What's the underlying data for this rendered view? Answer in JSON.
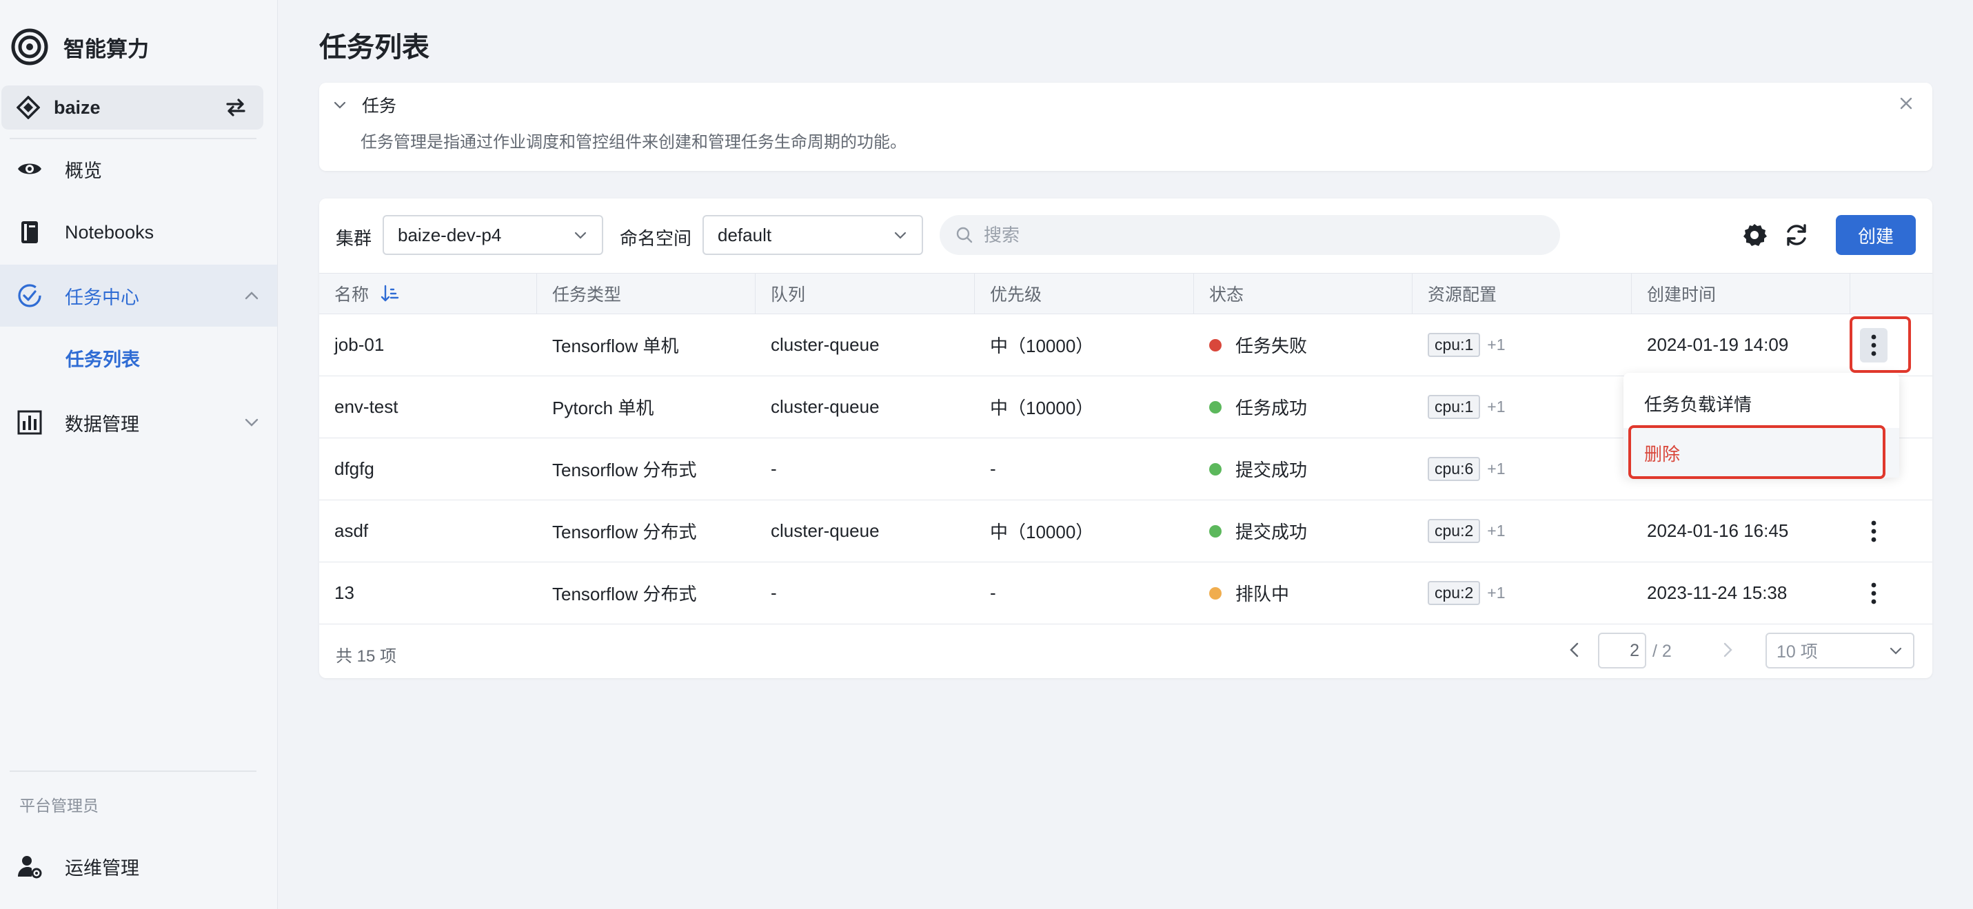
{
  "app": {
    "brand_title": "智能算力",
    "workspace": "baize"
  },
  "sidebar": {
    "items": [
      {
        "label": "概览"
      },
      {
        "label": "Notebooks"
      },
      {
        "label": "任务中心"
      },
      {
        "label": "数据管理"
      }
    ],
    "sub_item": "任务列表",
    "section_label": "平台管理员",
    "bottom_item": "运维管理"
  },
  "page": {
    "title": "任务列表"
  },
  "info": {
    "title": "任务",
    "description": "任务管理是指通过作业调度和管控组件来创建和管理任务生命周期的功能。"
  },
  "toolbar": {
    "cluster_label": "集群",
    "cluster_value": "baize-dev-p4",
    "namespace_label": "命名空间",
    "namespace_value": "default",
    "search_placeholder": "搜索",
    "create_label": "创建"
  },
  "table": {
    "columns": [
      "名称",
      "任务类型",
      "队列",
      "优先级",
      "状态",
      "资源配置",
      "创建时间"
    ],
    "rows": [
      {
        "name": "job-01",
        "type": "Tensorflow 单机",
        "queue": "cluster-queue",
        "priority": "中（10000）",
        "status": "任务失败",
        "status_color": "#d9473b",
        "resource": "cpu:1",
        "resource_more": "+1",
        "created": "2024-01-19 14:09"
      },
      {
        "name": "env-test",
        "type": "Pytorch 单机",
        "queue": "cluster-queue",
        "priority": "中（10000）",
        "status": "任务成功",
        "status_color": "#5cb85c",
        "resource": "cpu:1",
        "resource_more": "+1",
        "created": ""
      },
      {
        "name": "dfgfg",
        "type": "Tensorflow 分布式",
        "queue": "-",
        "priority": "-",
        "status": "提交成功",
        "status_color": "#5cb85c",
        "resource": "cpu:6",
        "resource_more": "+1",
        "created": ""
      },
      {
        "name": "asdf",
        "type": "Tensorflow 分布式",
        "queue": "cluster-queue",
        "priority": "中（10000）",
        "status": "提交成功",
        "status_color": "#5cb85c",
        "resource": "cpu:2",
        "resource_more": "+1",
        "created": "2024-01-16 16:45"
      },
      {
        "name": "13",
        "type": "Tensorflow 分布式",
        "queue": "-",
        "priority": "-",
        "status": "排队中",
        "status_color": "#f0ad4e",
        "resource": "cpu:2",
        "resource_more": "+1",
        "created": "2023-11-24 15:38"
      }
    ]
  },
  "pagination": {
    "total": "共 15 项",
    "current_page": "2",
    "total_pages": "/ 2",
    "page_size": "10 项"
  },
  "row_menu": {
    "items": [
      {
        "label": "任务负载详情"
      },
      {
        "label": "删除"
      }
    ]
  },
  "colors": {
    "primary": "#2f6cd4",
    "danger": "#d9473b",
    "highlight": "#e0382c"
  }
}
